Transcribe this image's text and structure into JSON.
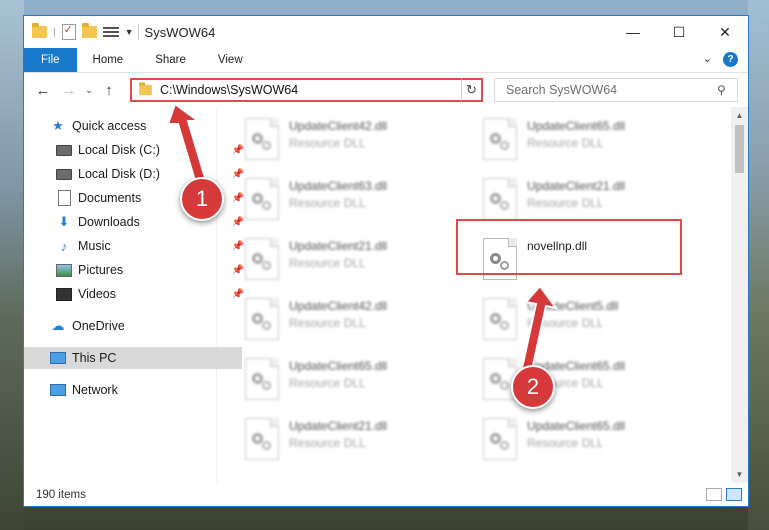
{
  "window": {
    "title": "SysWOW64",
    "controls": {
      "minimize": "—",
      "maximize": "☐",
      "close": "✕"
    }
  },
  "ribbon": {
    "tabs": [
      "File",
      "Home",
      "Share",
      "View"
    ],
    "help": "?"
  },
  "navigation": {
    "back": "←",
    "forward": "→",
    "recent": "⌄",
    "up": "↑",
    "address": "C:\\Windows\\SysWOW64",
    "refresh": "↻",
    "search_placeholder": "Search SysWOW64"
  },
  "sidebar": {
    "items": [
      {
        "label": "Quick access",
        "icon": "star-icon",
        "pinned": false
      },
      {
        "label": "Local Disk (C:)",
        "icon": "drive-icon",
        "pinned": true
      },
      {
        "label": "Local Disk (D:)",
        "icon": "drive-icon",
        "pinned": true
      },
      {
        "label": "Documents",
        "icon": "documents-icon",
        "pinned": true
      },
      {
        "label": "Downloads",
        "icon": "downloads-icon",
        "pinned": true
      },
      {
        "label": "Music",
        "icon": "music-icon",
        "pinned": true
      },
      {
        "label": "Pictures",
        "icon": "pictures-icon",
        "pinned": true
      },
      {
        "label": "Videos",
        "icon": "videos-icon",
        "pinned": true
      },
      {
        "label": "OneDrive",
        "icon": "onedrive-icon",
        "pinned": false
      },
      {
        "label": "This PC",
        "icon": "this-pc-icon",
        "pinned": false,
        "selected": true
      },
      {
        "label": "Network",
        "icon": "network-icon",
        "pinned": false
      }
    ]
  },
  "files": [
    {
      "name": "UpdateClient42.dll",
      "type": "Resource DLL"
    },
    {
      "name": "UpdateClient65.dll",
      "type": "Resource DLL"
    },
    {
      "name": "UpdateClient63.dll",
      "type": "Resource DLL"
    },
    {
      "name": "UpdateClient21.dll",
      "type": "Resource DLL"
    },
    {
      "name": "UpdateClient21.dll",
      "type": "Resource DLL"
    },
    {
      "name": "novellnp.dll",
      "type": ""
    },
    {
      "name": "UpdateClient42.dll",
      "type": "Resource DLL"
    },
    {
      "name": "UpdateClient5.dll",
      "type": "Resource DLL"
    },
    {
      "name": "UpdateClient65.dll",
      "type": "Resource DLL"
    },
    {
      "name": "UpdateClient65.dll",
      "type": "Resource DLL"
    },
    {
      "name": "UpdateClient21.dll",
      "type": "Resource DLL"
    },
    {
      "name": "UpdateClient65.dll",
      "type": "Resource DLL"
    }
  ],
  "status": {
    "item_count": "190 items"
  },
  "annotations": {
    "step1": "1",
    "step2": "2",
    "highlight_color": "#e04a4a",
    "badge_color": "#d6393a"
  }
}
